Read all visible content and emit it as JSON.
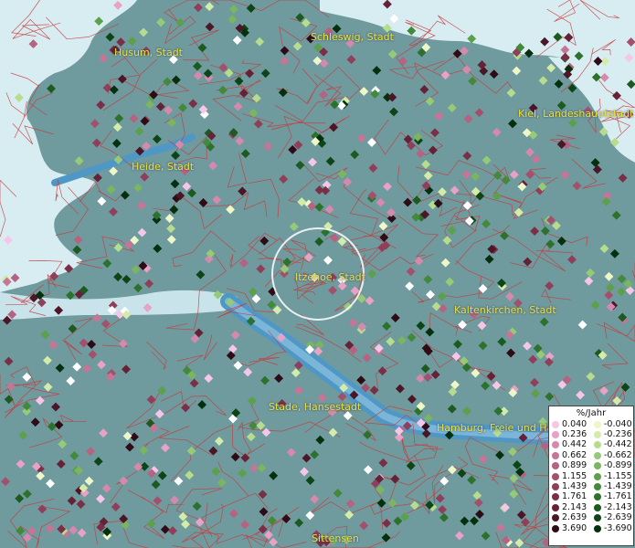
{
  "map": {
    "cities": [
      {
        "id": "husum",
        "label": "Husum, Stadt"
      },
      {
        "id": "schleswig",
        "label": "Schleswig, Stadt"
      },
      {
        "id": "kiel",
        "label": "Kiel, Landeshauptstadt"
      },
      {
        "id": "heide",
        "label": "Heide, Stadt"
      },
      {
        "id": "itzehoe",
        "label": "Itzehoe, Stadt"
      },
      {
        "id": "kaltenkirchen",
        "label": "Kaltenkirchen, Stadt"
      },
      {
        "id": "stade",
        "label": "Stade, Hansestadt"
      },
      {
        "id": "hamburg",
        "label": "Hamburg, Freie und Han"
      },
      {
        "id": "sittensen",
        "label": "Sittensen"
      }
    ],
    "legend": {
      "unit": "%/Jahr",
      "positive": [
        {
          "value": "0.040",
          "color": "#f6c6e8"
        },
        {
          "value": "0.236",
          "color": "#e7a2c6"
        },
        {
          "value": "0.442",
          "color": "#d58aad"
        },
        {
          "value": "0.662",
          "color": "#c67597"
        },
        {
          "value": "0.899",
          "color": "#b66281"
        },
        {
          "value": "1.155",
          "color": "#a3506d"
        },
        {
          "value": "1.439",
          "color": "#8f3f59"
        },
        {
          "value": "1.761",
          "color": "#7a2f47"
        },
        {
          "value": "2.143",
          "color": "#642236"
        },
        {
          "value": "2.639",
          "color": "#4b1626"
        },
        {
          "value": "3.690",
          "color": "#2f0b16"
        }
      ],
      "negative": [
        {
          "value": "-0.040",
          "color": "#eef7c8"
        },
        {
          "value": "-0.236",
          "color": "#d4ecaa"
        },
        {
          "value": "-0.442",
          "color": "#b6dc8e"
        },
        {
          "value": "-0.662",
          "color": "#97ca76"
        },
        {
          "value": "-0.899",
          "color": "#79b65f"
        },
        {
          "value": "-1.155",
          "color": "#5ca04b"
        },
        {
          "value": "-1.439",
          "color": "#43893a"
        },
        {
          "value": "-1.761",
          "color": "#2d722c"
        },
        {
          "value": "-2.143",
          "color": "#1b5b20"
        },
        {
          "value": "-2.639",
          "color": "#0d4516"
        },
        {
          "value": "-3.690",
          "color": "#04300e"
        }
      ]
    },
    "colors": {
      "land": "#6f9a9e",
      "sea": "#d8edf2",
      "river": "#4f98c6",
      "boundary": "#c83a3a",
      "label": "#e7e23a"
    }
  }
}
